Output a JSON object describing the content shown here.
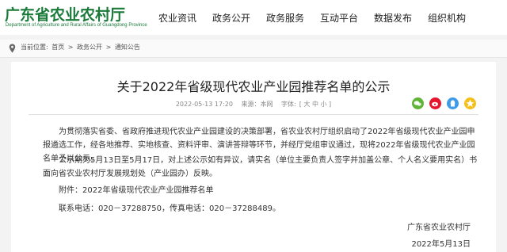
{
  "header": {
    "logo_title": "广东省农业农村厅",
    "logo_subtitle": "Department of Agriculture and Rural Affairs of Guangdong Province",
    "nav": [
      "农业资讯",
      "政务公开",
      "政务服务",
      "互动平台",
      "数据发布",
      "组织机构"
    ]
  },
  "breadcrumb": {
    "label": "当前位置:",
    "items": [
      "首页",
      "政务公开",
      "通知公告"
    ],
    "separator": ">"
  },
  "article": {
    "title": "关于2022年省级现代农业产业园推荐名单的公示",
    "date": "2022-05-13 17:20",
    "source": "来源：本网",
    "font_label": "字体:",
    "font_sizes": "[ 大  中  小 ]",
    "paragraphs": [
      "为贯彻落实省委、省政府推进现代农业产业园建设的决策部署，省农业农村厅组织启动了2022年省级现代农业产业园申报遴选工作，经各地推荐、实地核查、资料评审、演讲答辩等环节，并经厅党组审议通过，现将2022年省级现代农业产业园名单予以公示。",
      "公示期为5月13日至5月17日，对上述公示如有异议，请实名（单位主要负责人签字并加盖公章、个人名义要用实名）书面向省农业农村厅发展规划处（产业园办）反映。"
    ],
    "attachment": "附件：2022年省级现代农业产业园推荐名单",
    "contact": "联系电话：020－37288750，传真电话：020－37288489。",
    "signature": "广东省农业农村厅",
    "sign_date": "2022年5月13日"
  },
  "share": [
    "wechat-icon",
    "weibo-icon",
    "qq-icon",
    "qzone-icon"
  ],
  "colors": {
    "brand_green": "#1a7a3a"
  }
}
